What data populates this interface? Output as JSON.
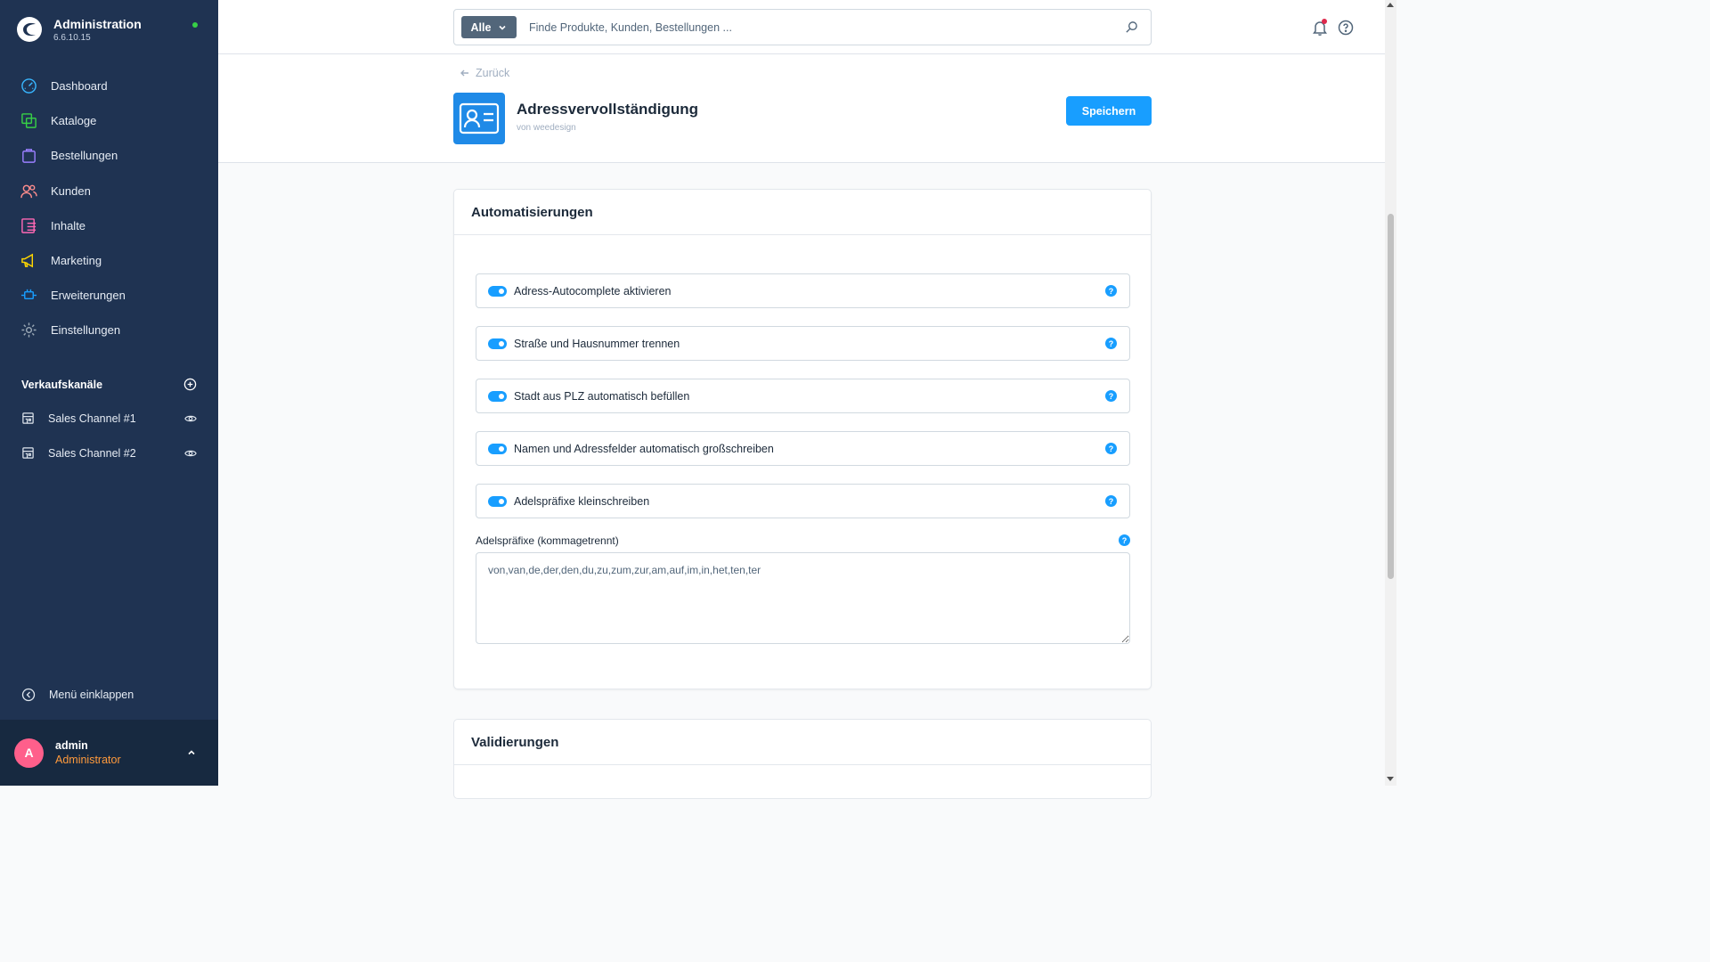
{
  "app": {
    "title": "Administration",
    "version": "6.6.10.15",
    "status_color": "#37d046"
  },
  "sidebar": {
    "items": [
      {
        "label": "Dashboard",
        "icon": "gauge-icon",
        "color": "#38b6ff"
      },
      {
        "label": "Kataloge",
        "icon": "catalog-icon",
        "color": "#37d046"
      },
      {
        "label": "Bestellungen",
        "icon": "shopping-bag-icon",
        "color": "#9a7fff"
      },
      {
        "label": "Kunden",
        "icon": "users-icon",
        "color": "#ff8d8d"
      },
      {
        "label": "Inhalte",
        "icon": "content-list-icon",
        "color": "#ff68b4"
      },
      {
        "label": "Marketing",
        "icon": "megaphone-icon",
        "color": "#ffd700"
      },
      {
        "label": "Erweiterungen",
        "icon": "plug-icon",
        "color": "#189eff"
      },
      {
        "label": "Einstellungen",
        "icon": "gear-icon",
        "color": "#9aa8b5"
      }
    ],
    "sales_channels_title": "Verkaufskanäle",
    "sales_channels": [
      {
        "label": "Sales Channel #1"
      },
      {
        "label": "Sales Channel #2"
      }
    ],
    "collapse_label": "Menü einklappen"
  },
  "user": {
    "initial": "A",
    "name": "admin",
    "role": "Administrator",
    "avatar_color": "#ff5f8b",
    "role_color": "#ff9a3c"
  },
  "search": {
    "type_label": "Alle",
    "placeholder": "Finde Produkte, Kunden, Bestellungen ..."
  },
  "header": {
    "back_label": "Zurück",
    "extension_title": "Adressvervollständigung",
    "vendor": "von weedesign",
    "save_label": "Speichern",
    "accent_color": "#189eff"
  },
  "card": {
    "title": "Automatisierungen",
    "switches": [
      {
        "label": "Adress-Autocomplete aktivieren",
        "enabled": true
      },
      {
        "label": "Straße und Hausnummer trennen",
        "enabled": true
      },
      {
        "label": "Stadt aus PLZ automatisch befüllen",
        "enabled": true
      },
      {
        "label": "Namen und Adressfelder automatisch großschreiben",
        "enabled": true
      },
      {
        "label": "Adelspräfixe kleinschreiben",
        "enabled": true
      }
    ],
    "textarea_label": "Adelspräfixe (kommagetrennt)",
    "textarea_value": "von,van,de,der,den,du,zu,zum,zur,am,auf,im,in,het,ten,ter"
  },
  "card2": {
    "title": "Validierungen"
  }
}
